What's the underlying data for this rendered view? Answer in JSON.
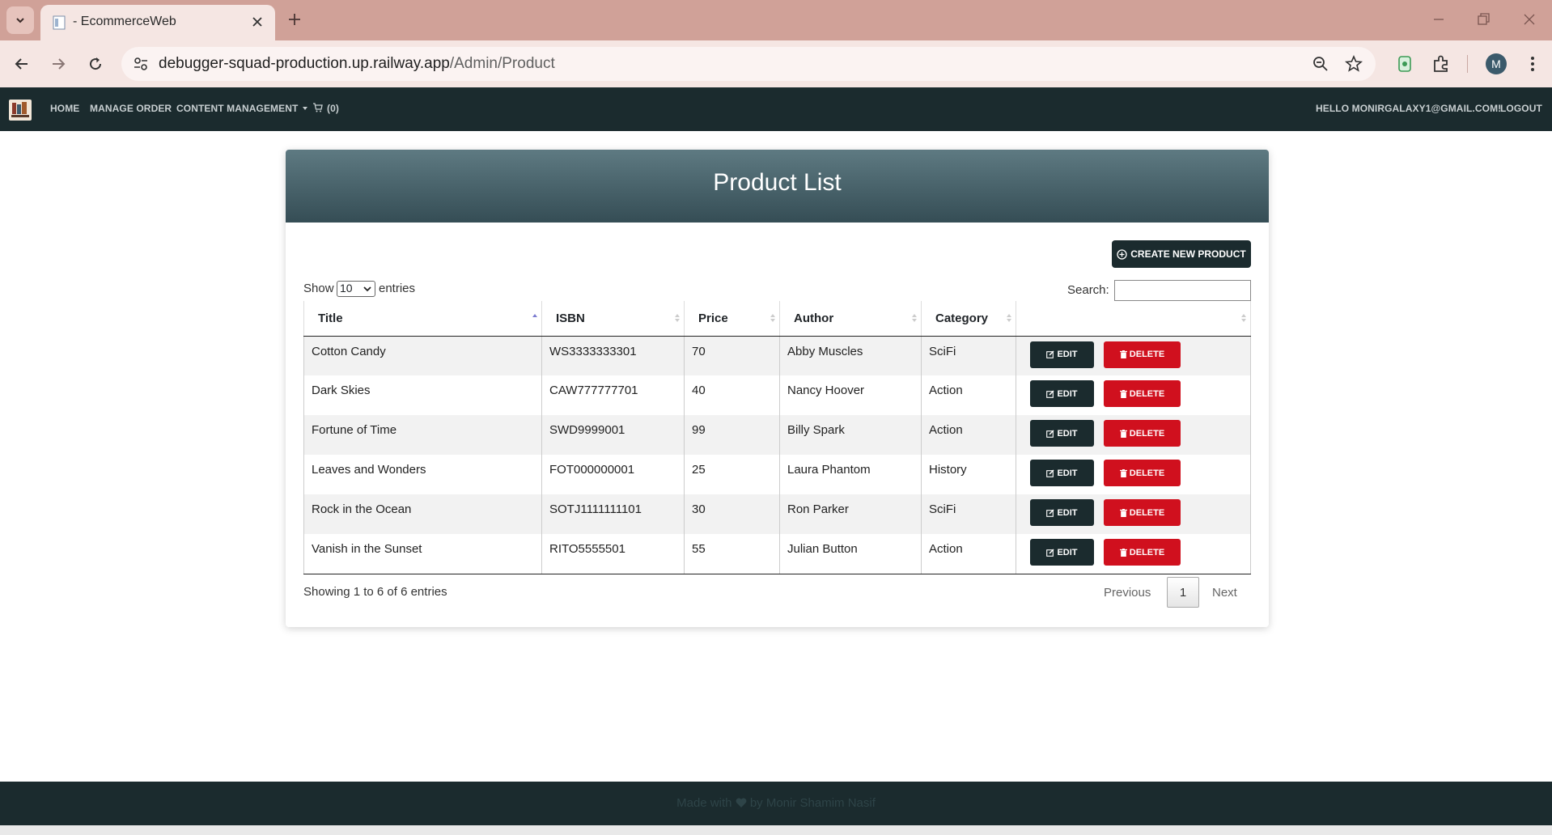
{
  "browser": {
    "tab_title": "- EcommerceWeb",
    "url_host": "debugger-squad-production.up.railway.app",
    "url_path": "/Admin/Product",
    "profile_initial": "M"
  },
  "navbar": {
    "home": "HOME",
    "manage_order": "MANAGE ORDER",
    "content_management": "CONTENT MANAGEMENT",
    "cart_count": "(0)",
    "greeting": "HELLO MONIRGALAXY1@GMAIL.COM!",
    "logout": "LOGOUT"
  },
  "card": {
    "title": "Product List",
    "create_button": "CREATE NEW PRODUCT",
    "show_label": "Show",
    "page_length": "10",
    "entries_label": "entries",
    "search_label": "Search:"
  },
  "table": {
    "columns": [
      "Title",
      "ISBN",
      "Price",
      "Author",
      "Category"
    ],
    "rows": [
      {
        "title": "Cotton Candy",
        "isbn": "WS3333333301",
        "price": "70",
        "author": "Abby Muscles",
        "category": "SciFi"
      },
      {
        "title": "Dark Skies",
        "isbn": "CAW777777701",
        "price": "40",
        "author": "Nancy Hoover",
        "category": "Action"
      },
      {
        "title": "Fortune of Time",
        "isbn": "SWD9999001",
        "price": "99",
        "author": "Billy Spark",
        "category": "Action"
      },
      {
        "title": "Leaves and Wonders",
        "isbn": "FOT000000001",
        "price": "25",
        "author": "Laura Phantom",
        "category": "History"
      },
      {
        "title": "Rock in the Ocean",
        "isbn": "SOTJ1111111101",
        "price": "30",
        "author": "Ron Parker",
        "category": "SciFi"
      },
      {
        "title": "Vanish in the Sunset",
        "isbn": "RITO5555501",
        "price": "55",
        "author": "Julian Button",
        "category": "Action"
      }
    ],
    "edit_label": "EDIT",
    "delete_label": "DELETE"
  },
  "pagination": {
    "info": "Showing 1 to 6 of 6 entries",
    "previous": "Previous",
    "current": "1",
    "next": "Next"
  },
  "footer": {
    "text_before": "Made with",
    "text_after": "by Monir Shamim Nasif"
  },
  "colors": {
    "navbar_bg": "#1b2b2e",
    "header_gradient_top": "#5e7a82",
    "header_gradient_bottom": "#354d55",
    "delete_red": "#d0101e",
    "tab_strip": "#d0a198"
  }
}
